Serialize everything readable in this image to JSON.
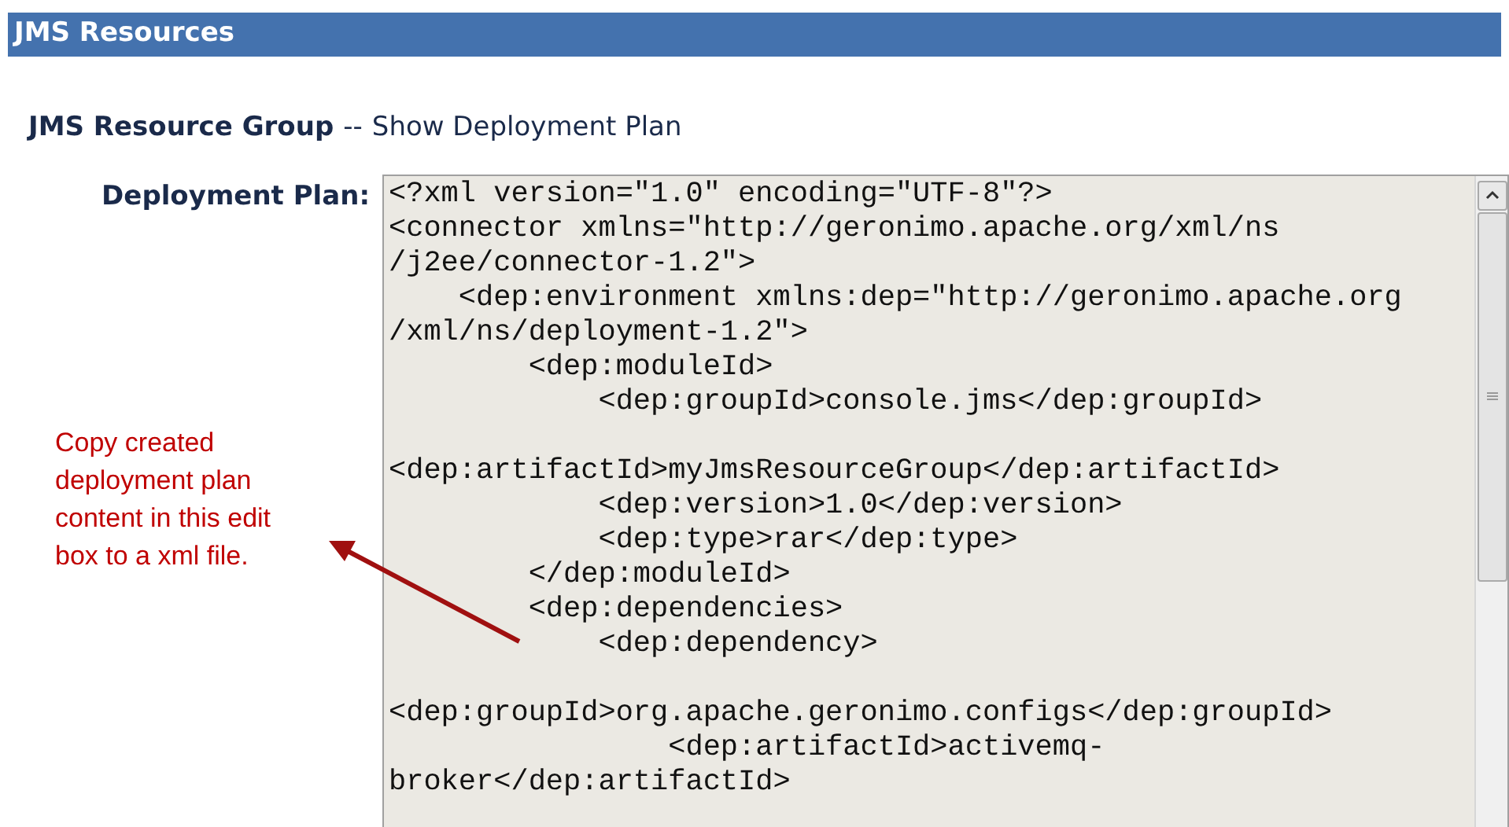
{
  "header": {
    "title": "JMS Resources"
  },
  "heading": {
    "title": "JMS Resource Group",
    "separator": "--",
    "subtitle": "Show Deployment Plan"
  },
  "plan_field": {
    "label": "Deployment Plan:",
    "blocks": [
      [
        "<?xml version=\"1.0\" encoding=\"UTF-8\"?>",
        "<connector xmlns=\"http://geronimo.apache.org/xml/ns",
        "/j2ee/connector-1.2\">",
        "    <dep:environment xmlns:dep=\"http://geronimo.apache.org",
        "/xml/ns/deployment-1.2\">",
        "        <dep:moduleId>",
        "            <dep:groupId>console.jms</dep:groupId>"
      ],
      [
        "<dep:artifactId>myJmsResourceGroup</dep:artifactId>",
        "            <dep:version>1.0</dep:version>",
        "            <dep:type>rar</dep:type>",
        "        </dep:moduleId>",
        "        <dep:dependencies>",
        "            <dep:dependency>"
      ],
      [
        "<dep:groupId>org.apache.geronimo.configs</dep:groupId>",
        "                <dep:artifactId>activemq-",
        "broker</dep:artifactId>"
      ]
    ]
  },
  "annotation": {
    "text": "Copy created deployment plan content in this edit box to a xml file."
  }
}
